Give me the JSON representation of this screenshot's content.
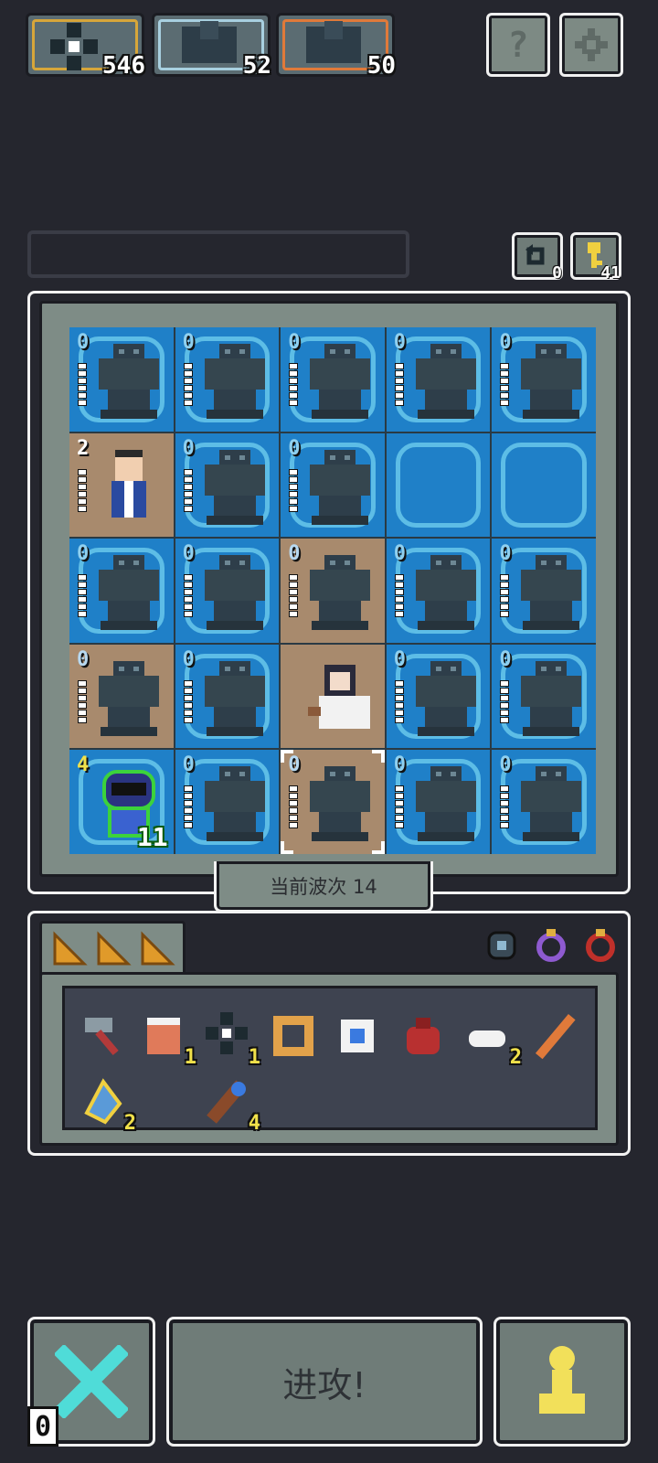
{
  "resources": [
    {
      "icon": "gem-cluster-icon",
      "count": "546",
      "border": "#d7a63a"
    },
    {
      "icon": "gargoyle-statue-icon",
      "count": "52",
      "border": "#a8d0e0"
    },
    {
      "icon": "gargoyle-statue-icon",
      "count": "50",
      "border": "#e07a3a"
    }
  ],
  "top_buttons": {
    "help": "?",
    "settings_icon": "gear-icon"
  },
  "side_buttons": {
    "undo_count": "0",
    "key_count": "41"
  },
  "board": {
    "rows": [
      [
        {
          "n": "0",
          "t": "water",
          "u": "gargoyle"
        },
        {
          "n": "0",
          "t": "water",
          "u": "gargoyle"
        },
        {
          "n": "0",
          "t": "water",
          "u": "gargoyle"
        },
        {
          "n": "0",
          "t": "water",
          "u": "gargoyle"
        },
        {
          "n": "0",
          "t": "water",
          "u": "gargoyle"
        }
      ],
      [
        {
          "n": "2",
          "t": "sand",
          "u": "villager"
        },
        {
          "n": "0",
          "t": "water",
          "u": "gargoyle"
        },
        {
          "n": "0",
          "t": "water",
          "u": "gargoyle"
        },
        {
          "n": "",
          "t": "water",
          "u": "empty"
        },
        {
          "n": "",
          "t": "water",
          "u": "empty"
        }
      ],
      [
        {
          "n": "0",
          "t": "water",
          "u": "gargoyle"
        },
        {
          "n": "0",
          "t": "water",
          "u": "gargoyle"
        },
        {
          "n": "0",
          "t": "sand",
          "u": "gargoyle"
        },
        {
          "n": "0",
          "t": "water",
          "u": "gargoyle"
        },
        {
          "n": "0",
          "t": "water",
          "u": "gargoyle"
        }
      ],
      [
        {
          "n": "0",
          "t": "sand",
          "u": "gargoyle"
        },
        {
          "n": "0",
          "t": "water",
          "u": "gargoyle"
        },
        {
          "n": "",
          "t": "sand",
          "u": "princess"
        },
        {
          "n": "0",
          "t": "water",
          "u": "gargoyle"
        },
        {
          "n": "0",
          "t": "water",
          "u": "gargoyle"
        }
      ],
      [
        {
          "n": "4",
          "t": "water",
          "u": "knight",
          "hp": "11"
        },
        {
          "n": "0",
          "t": "water",
          "u": "gargoyle"
        },
        {
          "n": "0",
          "t": "sand",
          "u": "gargoyle",
          "selected": true
        },
        {
          "n": "0",
          "t": "water",
          "u": "gargoyle"
        },
        {
          "n": "0",
          "t": "water",
          "u": "gargoyle"
        }
      ]
    ]
  },
  "wave_label": "当前波次 14",
  "inventory": {
    "tabs": [
      "cheese-icon",
      "cheese-icon",
      "cheese-icon"
    ],
    "equipment": [
      "amulet-icon",
      "ring-purple-icon",
      "ring-red-icon"
    ],
    "items": [
      {
        "icon": "hammer-icon",
        "qty": ""
      },
      {
        "icon": "drum-icon",
        "qty": "1"
      },
      {
        "icon": "gem-cluster-icon",
        "qty": "1"
      },
      {
        "icon": "wooden-frame-icon",
        "qty": ""
      },
      {
        "icon": "crystal-icon",
        "qty": ""
      },
      {
        "icon": "loot-bag-icon",
        "qty": ""
      },
      {
        "icon": "cloud-icon",
        "qty": "2"
      },
      {
        "icon": "stick-icon",
        "qty": ""
      },
      {
        "icon": "blue-crystal-icon",
        "qty": "2"
      },
      {
        "icon": "spyglass-icon",
        "qty": "4"
      }
    ]
  },
  "bottom": {
    "attack_label": "进攻!",
    "cancel_count": "0"
  },
  "colors": {
    "water": "#1f80c8",
    "sand": "#a88a6d",
    "frame": "#7e8c86",
    "bg": "#25262e"
  }
}
